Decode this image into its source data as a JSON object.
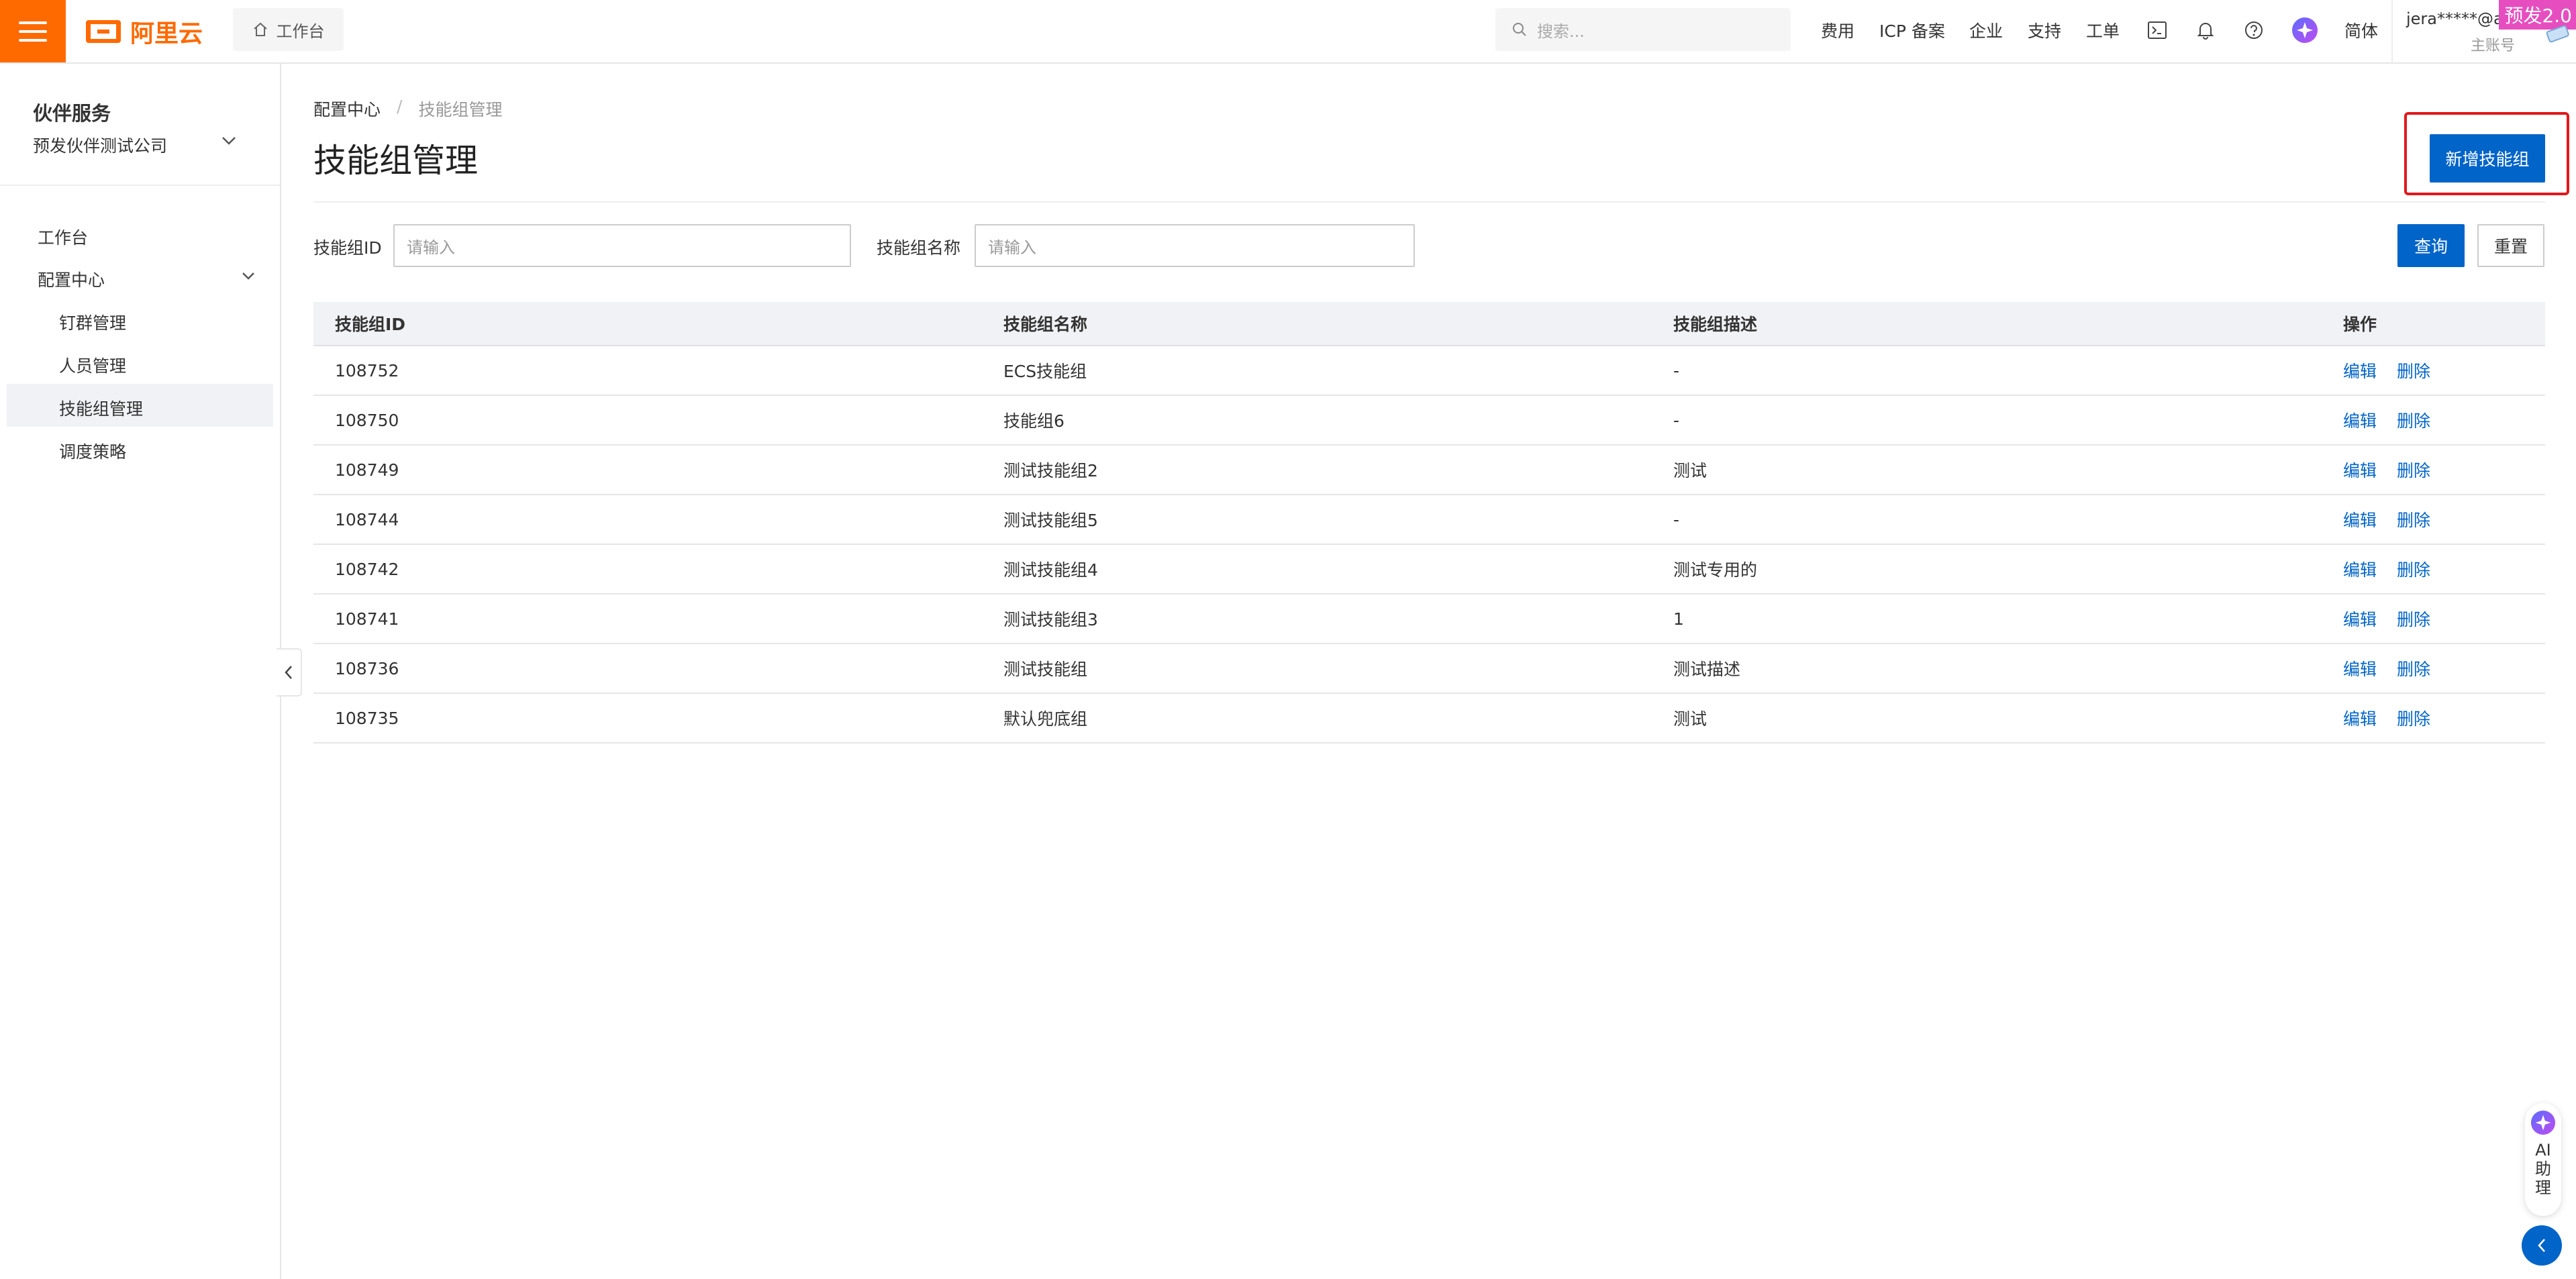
{
  "topbar": {
    "logo_text": "阿里云",
    "workbench": "工作台",
    "search_placeholder": "搜索...",
    "nav": [
      "费用",
      "ICP 备案",
      "企业",
      "支持",
      "工单"
    ],
    "lang": "简体",
    "user_name": "jera*****@al...",
    "user_role": "主账号",
    "env_badge": "预发2.0"
  },
  "sidebar": {
    "title": "伙伴服务",
    "company": "预发伙伴测试公司",
    "items": [
      {
        "label": "工作台"
      },
      {
        "label": "配置中心"
      }
    ],
    "subitems": [
      {
        "label": "钉群管理"
      },
      {
        "label": "人员管理"
      },
      {
        "label": "技能组管理"
      },
      {
        "label": "调度策略"
      }
    ]
  },
  "breadcrumb": {
    "parent": "配置中心",
    "sep": "/",
    "current": "技能组管理"
  },
  "page": {
    "title": "技能组管理",
    "add_button": "新增技能组"
  },
  "filters": {
    "id_label": "技能组ID",
    "id_placeholder": "请输入",
    "name_label": "技能组名称",
    "name_placeholder": "请输入",
    "query": "查询",
    "reset": "重置"
  },
  "table": {
    "headers": [
      "技能组ID",
      "技能组名称",
      "技能组描述",
      "操作"
    ],
    "edit": "编辑",
    "delete": "删除",
    "rows": [
      {
        "id": "108752",
        "name": "ECS技能组",
        "desc": "-"
      },
      {
        "id": "108750",
        "name": "技能组6",
        "desc": "-"
      },
      {
        "id": "108749",
        "name": "测试技能组2",
        "desc": "测试"
      },
      {
        "id": "108744",
        "name": "测试技能组5",
        "desc": "-"
      },
      {
        "id": "108742",
        "name": "测试技能组4",
        "desc": "测试专用的"
      },
      {
        "id": "108741",
        "name": "测试技能组3",
        "desc": "1"
      },
      {
        "id": "108736",
        "name": "测试技能组",
        "desc": "测试描述"
      },
      {
        "id": "108735",
        "name": "默认兜底组",
        "desc": "测试"
      }
    ]
  },
  "ai_assistant": {
    "label": "AI助理"
  },
  "colors": {
    "brand": "#ff6a00",
    "primary": "#0064c8",
    "highlight": "#e0181c"
  }
}
